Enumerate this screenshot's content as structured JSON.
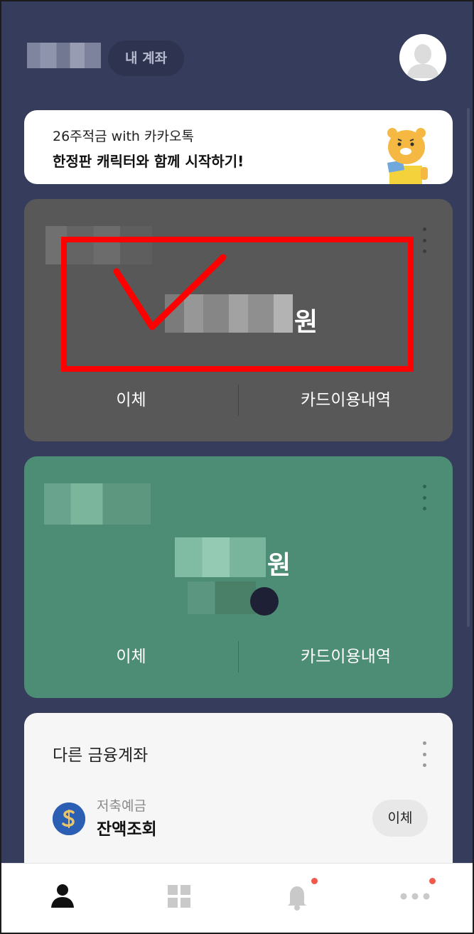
{
  "header": {
    "my_account_label": "내 계좌"
  },
  "banner": {
    "subtitle": "26주적금 with 카카오톡",
    "title": "한정판 캐릭터와 함께 시작하기!"
  },
  "accounts": [
    {
      "currency_unit": "원",
      "actions": [
        "이체",
        "카드이용내역"
      ],
      "color": "#585858"
    },
    {
      "currency_unit": "원",
      "actions": [
        "이체",
        "카드이용내역"
      ],
      "color": "#4e8d75"
    }
  ],
  "other_accounts": {
    "title": "다른 금융계좌",
    "items": [
      {
        "type": "저축예금",
        "status": "잔액조회",
        "action": "이체",
        "icon": "bank-logo-icon"
      }
    ]
  },
  "bottom_nav": {
    "items": [
      {
        "icon": "person-icon",
        "active": true,
        "badge": false
      },
      {
        "icon": "grid-icon",
        "active": false,
        "badge": false
      },
      {
        "icon": "bell-icon",
        "active": false,
        "badge": true
      },
      {
        "icon": "more-dots-icon",
        "active": false,
        "badge": true
      }
    ]
  },
  "colors": {
    "background": "#363c5c",
    "accent_red": "#ff0000",
    "badge": "#ef5a4a"
  }
}
